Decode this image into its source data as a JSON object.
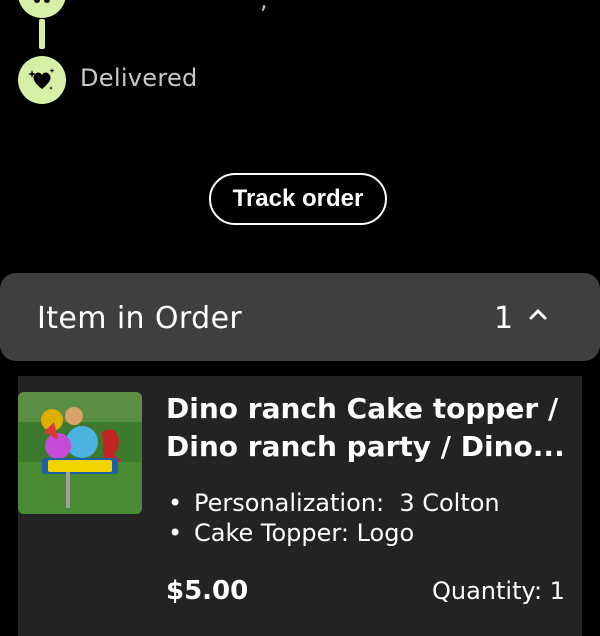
{
  "timeline": {
    "prev_step_label": ",",
    "delivered_label": "Delivered"
  },
  "actions": {
    "track_order": "Track order"
  },
  "order_section": {
    "title": "Item in Order",
    "count": "1"
  },
  "item": {
    "title_line1": "Dino ranch Cake topper /",
    "title_line2": "Dino ranch party / Dino...",
    "attributes": [
      {
        "label": "Personalization:",
        "value": "3 Colton"
      },
      {
        "label": "Cake Topper:",
        "value": "Logo"
      }
    ],
    "price": "$5.00",
    "quantity": "Quantity: 1"
  },
  "colors": {
    "accent": "#d7f0a8",
    "panel": "#3f3f3f",
    "card": "#232323"
  }
}
